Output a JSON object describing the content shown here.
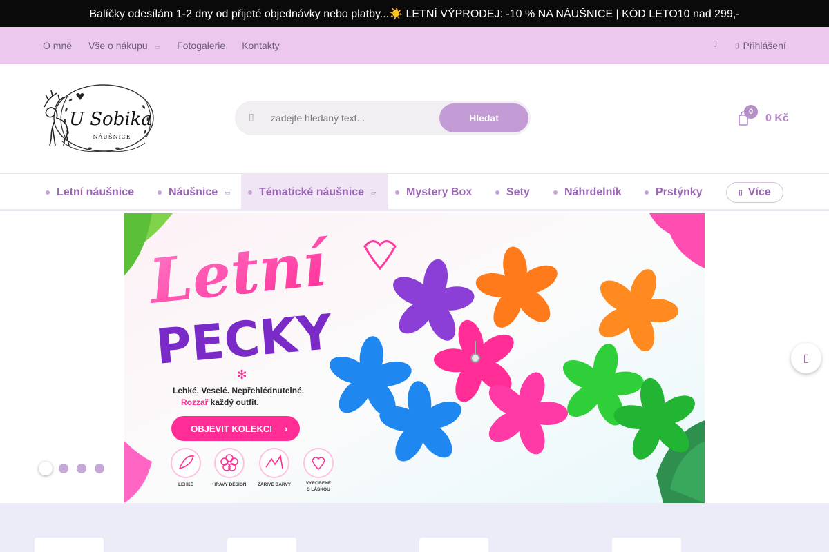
{
  "announcement": {
    "text": "Balíčky odesílám 1-2 dny od přijeté objednávky nebo platby...☀️ LETNÍ VÝPRODEJ: -10 % NA NÁUŠNICE | KÓD LETO10 nad 299,-"
  },
  "utility_nav": {
    "items": [
      {
        "label": "O mně"
      },
      {
        "label": "Vše o nákupu"
      },
      {
        "label": "Fotogalerie"
      },
      {
        "label": "Kontakty"
      }
    ],
    "login_label": "Přihlášení"
  },
  "logo": {
    "title": "U Sobika",
    "subtitle": "NÁUŠNICE"
  },
  "search": {
    "placeholder": "zadejte hledaný text...",
    "button_label": "Hledat"
  },
  "cart": {
    "count": "0",
    "total": "0 Kč"
  },
  "main_nav": {
    "items": [
      {
        "label": "Letní náušnice"
      },
      {
        "label": "Náušnice"
      },
      {
        "label": "Tématické náušnice"
      },
      {
        "label": "Mystery Box"
      },
      {
        "label": "Sety"
      },
      {
        "label": "Náhrdelník"
      },
      {
        "label": "Prstýnky"
      }
    ],
    "more_label": "Více"
  },
  "banner": {
    "title_line1": "Letní",
    "title_line2": "PECKY",
    "tagline": "Lehké. Veselé. Nepřehlédnutelné.",
    "tagline2_highlight": "Rozzař",
    "tagline2_rest": " každý outfit.",
    "cta": "OBJEVIT KOLEKCI",
    "features": [
      {
        "label": "LEHKÉ"
      },
      {
        "label": "HRAVÝ DESIGN"
      },
      {
        "label": "ZÁŘIVÉ BARVY"
      },
      {
        "label": "VYROBENÉ",
        "label2": "S LÁSKOU"
      }
    ]
  },
  "carousel": {
    "slides": 4,
    "active": 1
  },
  "colors": {
    "accent": "#9a66b4",
    "utility_bg": "#ecc8ef",
    "button": "#c39bd5"
  }
}
